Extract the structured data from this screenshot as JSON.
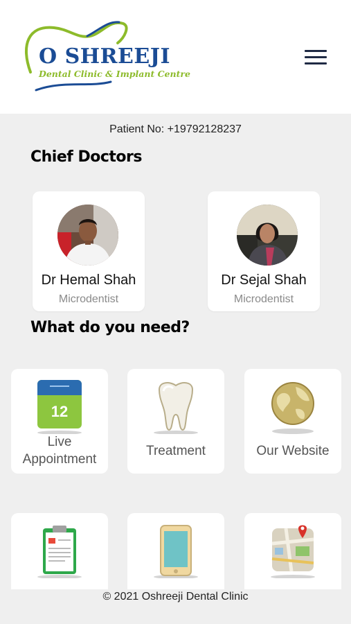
{
  "header": {
    "logo_title": "O SHREEJI",
    "logo_subtitle": "Dental Clinic & Implant Centre",
    "menu_icon": "hamburger-menu-icon",
    "colors": {
      "brand_blue": "#1b4c95",
      "brand_green": "#8dbb2b"
    }
  },
  "patient": {
    "label": "Patient No: +19792128237"
  },
  "chief_doctors": {
    "title": "Chief Doctors",
    "doctors": [
      {
        "name": "Dr Hemal Shah",
        "role": "Microdentist"
      },
      {
        "name": "Dr Sejal Shah",
        "role": "Microdentist"
      }
    ]
  },
  "needs": {
    "title": "What do you need?",
    "tiles": [
      {
        "label_line1": "Live",
        "label_line2": "Appointment",
        "icon": "calendar-icon",
        "calendar_day": "12"
      },
      {
        "label": "Treatment",
        "icon": "tooth-icon"
      },
      {
        "label": "Our Website",
        "icon": "globe-icon"
      },
      {
        "icon": "clipboard-icon"
      },
      {
        "icon": "phone-icon"
      },
      {
        "icon": "map-icon"
      }
    ]
  },
  "footer": {
    "copyright": "© 2021 Oshreeji Dental Clinic"
  }
}
